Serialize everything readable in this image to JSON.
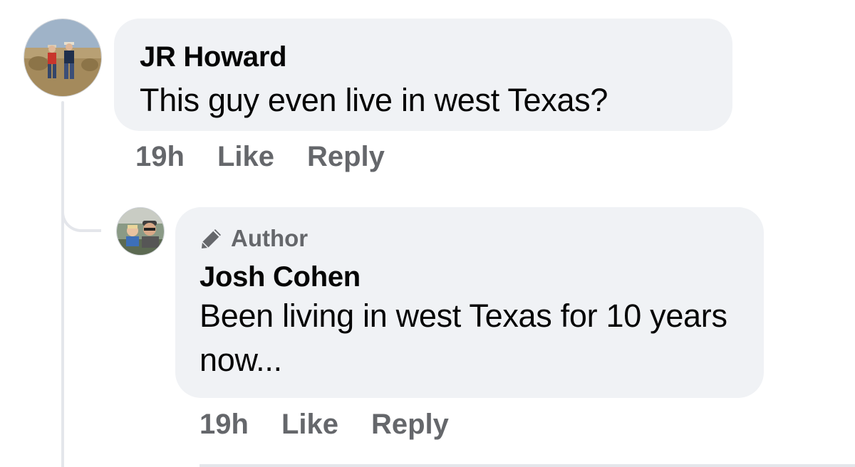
{
  "comments": [
    {
      "author": "JR Howard",
      "text": "This guy even live in west Texas?",
      "time": "19h",
      "like_label": "Like",
      "reply_label": "Reply"
    }
  ],
  "reply": {
    "badge_label": "Author",
    "badge_icon": "pencil-icon",
    "author": "Josh Cohen",
    "text": "Been living in west Texas for 10 years now...",
    "time": "19h",
    "like_label": "Like",
    "reply_label": "Reply"
  },
  "colors": {
    "bubble_bg": "#f0f2f5",
    "secondary_text": "#65676b",
    "primary_text": "#050505",
    "thread_line": "#e4e6eb"
  }
}
